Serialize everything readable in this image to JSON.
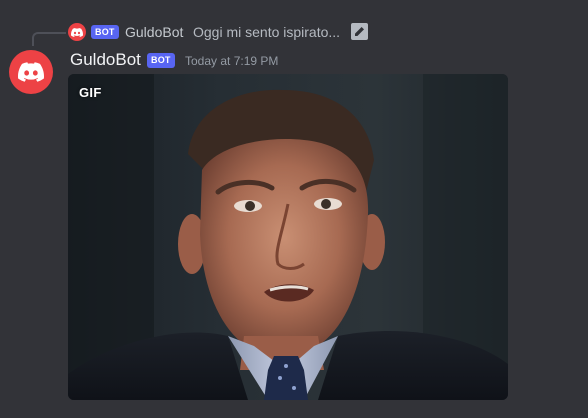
{
  "reply": {
    "author": "GuldoBot",
    "bot_tag": "BOT",
    "preview_text": "Oggi mi sento ispirato...",
    "avatar_icon": "discord-logo-icon",
    "attachment_icon": "image-attachment-icon"
  },
  "message": {
    "author": "GuldoBot",
    "bot_tag": "BOT",
    "timestamp": "Today at 7:19 PM",
    "avatar_icon": "discord-logo-icon"
  },
  "embed": {
    "badge": "GIF"
  },
  "colors": {
    "background": "#323338",
    "avatar": "#ed4245",
    "bot_tag": "#5865f2",
    "author": "#f2f3f5",
    "timestamp": "#949ba4"
  }
}
